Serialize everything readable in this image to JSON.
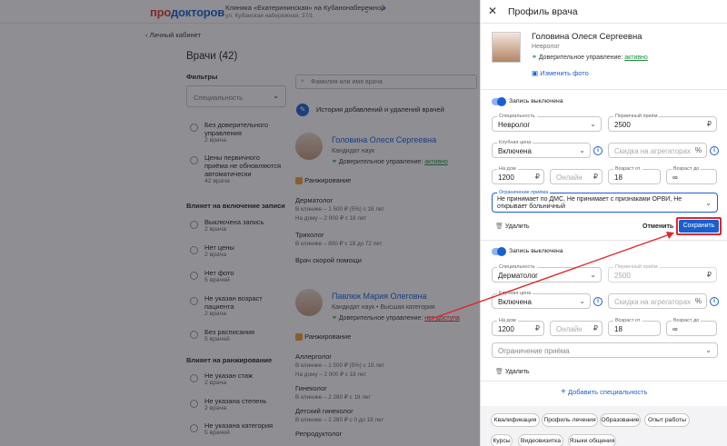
{
  "header": {
    "logo_part1": "про",
    "logo_part2": "докторов",
    "clinic_name": "Клиника «Екатерининская» на Кубанонабережной",
    "clinic_address": "ул. Кубанская набережная, 37/1"
  },
  "back_label": "Личный кабинет",
  "page_title": "Врачи (42)",
  "filters": {
    "title": "Фильтры",
    "specialty_placeholder": "Специальность",
    "group1": [
      {
        "label": "Без доверительного управления",
        "count": "2 врача"
      },
      {
        "label": "Цены первичного приёма не обновляются автоматически",
        "count": "42 врача"
      }
    ],
    "group2_title": "Влияет на включение записи",
    "group2": [
      {
        "label": "Выключена запись",
        "count": "2 врача"
      },
      {
        "label": "Нет цены",
        "count": "2 врача"
      },
      {
        "label": "Нет фото",
        "count": "5 врачей"
      },
      {
        "label": "Не указан возраст пациента",
        "count": "2 врача"
      },
      {
        "label": "Без расписания",
        "count": "5 врачей"
      }
    ],
    "group3_title": "Влияет на ранжирование",
    "group3": [
      {
        "label": "Не указан стаж",
        "count": "2 врача"
      },
      {
        "label": "Не указана степень",
        "count": "2 врача"
      },
      {
        "label": "Не указана категория",
        "count": "5 врачей"
      }
    ]
  },
  "search": {
    "placeholder": "Фамилия или имя врача"
  },
  "history_link": "История добавлений и удалений врачей",
  "doctors": [
    {
      "name": "Головина Олеся Сергеевна",
      "degree": "Кандидат наук",
      "trust_label": "Доверительное управление:",
      "trust_value": "активно",
      "ranking": "Ранжирование",
      "specs": [
        {
          "name": "Дерматолог",
          "line1": "В клинике – 1 500 ₽ (5%) с 18 лет",
          "line2": "На дому – 2 000 ₽ с 18 лет"
        },
        {
          "name": "Трихолог",
          "line1": "В клинике – 800 ₽ с 18 до 72 лет",
          "line2": ""
        },
        {
          "name": "Врач скорой помощи",
          "line1": "",
          "line2": ""
        }
      ]
    },
    {
      "name": "Павлюк Мария Олеговна",
      "degree": "Кандидат наук • Высшая категория",
      "trust_label": "Доверительное управление:",
      "trust_value": "нет доступа",
      "ranking": "Ранжирование",
      "specs": [
        {
          "name": "Аллерголог",
          "line1": "В клинике – 1 500 ₽ (5%) с 18 лет",
          "line2": "На дому – 2 000 ₽ с 18 лет"
        },
        {
          "name": "Гинеколог",
          "line1": "В клинике – 2 280 ₽ с 18 лет",
          "line2": ""
        },
        {
          "name": "Детский гинеколог",
          "line1": "В клинике – 2 280 ₽ с 0 до 18 лет",
          "line2": ""
        },
        {
          "name": "Репродуктолог",
          "line1": "",
          "line2": ""
        }
      ]
    }
  ],
  "panel": {
    "title": "Профиль врача",
    "doctor_name": "Головина Олеся Сергеевна",
    "doctor_spec": "Невролог",
    "trust_label": "Доверительное управление:",
    "trust_value": "активно",
    "change_photo": "Изменить фото",
    "block1": {
      "toggle_label": "Запись выключена",
      "specialty_label": "Специальность",
      "specialty_value": "Невролог",
      "price_label": "Первичный приём",
      "price_value": "2500",
      "club_label": "Клубная цена",
      "club_value": "Включена",
      "discount_placeholder": "Скидка на агрегаторах",
      "home_label": "На дом",
      "home_value": "1200",
      "online_placeholder": "Онлайн",
      "age_from_label": "Возраст от",
      "age_from_value": "18",
      "age_to_label": "Возраст до",
      "age_to_value": "∞",
      "restrict_label": "Ограничение приёма",
      "restrict_value": "Не принимает по ДМС, Не принимает с признаками ОРВИ, Не открывает больничный",
      "delete": "Удалить",
      "cancel": "Отменить",
      "save": "Сохранить"
    },
    "block2": {
      "toggle_label": "Запись выключена",
      "specialty_label": "Специальность",
      "specialty_value": "Дерматолог",
      "price_label": "Первичный приём",
      "price_placeholder": "2500",
      "club_label": "Клубная цена",
      "club_value": "Включена",
      "discount_placeholder": "Скидка на агрегаторах",
      "home_label": "На дом",
      "home_value": "1200",
      "online_placeholder": "Онлайн",
      "age_from_label": "Возраст от",
      "age_from_value": "18",
      "age_to_label": "Возраст до",
      "age_to_value": "∞",
      "restrict_placeholder": "Ограничение приёма",
      "delete": "Удалить"
    },
    "add_specialty": "Добавить специальность",
    "chips": [
      "Квалификация",
      "Профиль лечения",
      "Образование",
      "Опыт работы",
      "Курсы",
      "Видеовизитка",
      "Языки общения"
    ]
  },
  "currency": "₽",
  "percent": "%",
  "colors": {
    "accent": "#1a5fd0",
    "logo_red": "#e4322b",
    "highlight_red": "#e0262d"
  }
}
